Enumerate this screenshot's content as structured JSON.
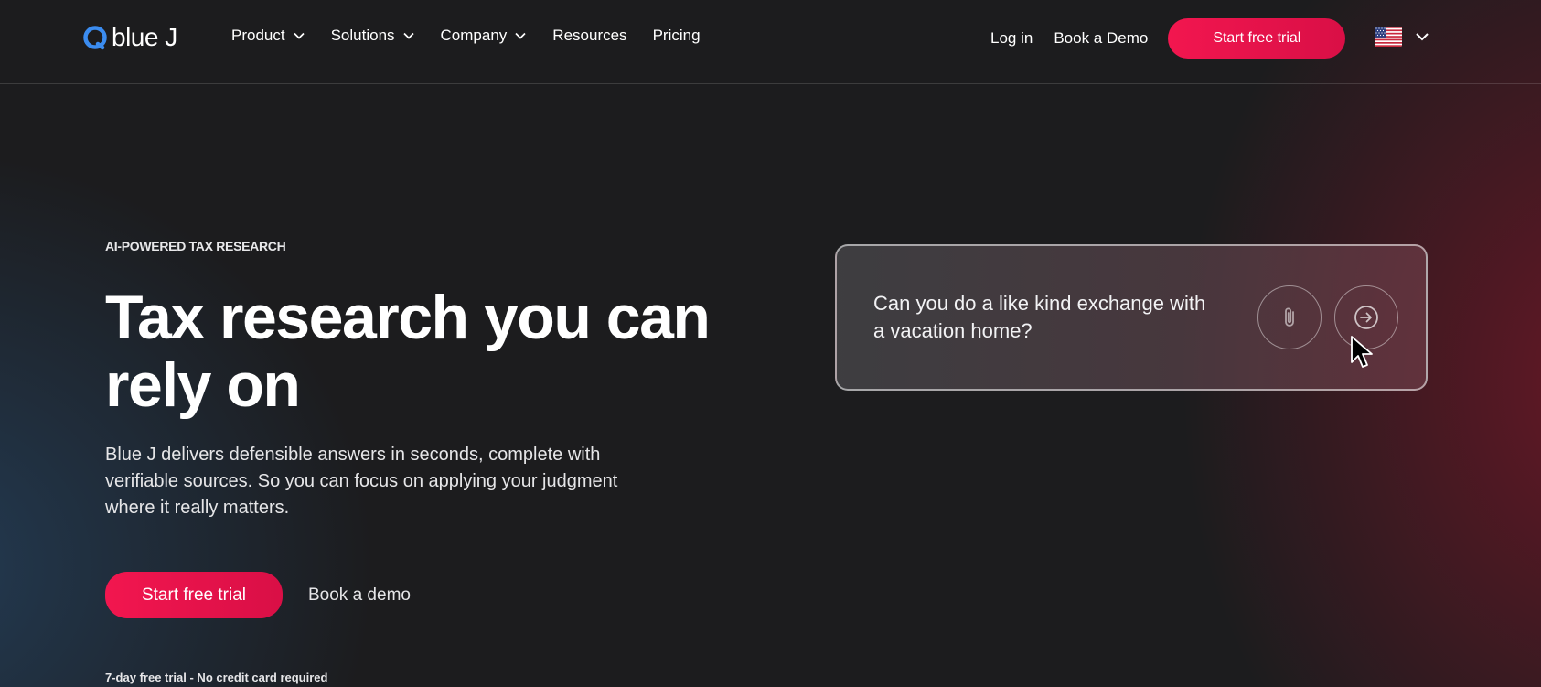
{
  "header": {
    "logo_text": "blue J",
    "nav": [
      {
        "label": "Product",
        "has_menu": true
      },
      {
        "label": "Solutions",
        "has_menu": true
      },
      {
        "label": "Company",
        "has_menu": true
      },
      {
        "label": "Resources",
        "has_menu": false
      },
      {
        "label": "Pricing",
        "has_menu": false
      }
    ],
    "login_label": "Log in",
    "book_demo_label": "Book a Demo",
    "trial_label": "Start free trial"
  },
  "hero": {
    "eyebrow": "AI-POWERED TAX RESEARCH",
    "headline": "Tax research you can rely on",
    "subcopy": "Blue J delivers defensible answers in seconds, complete with verifiable sources. So you can focus on applying your judgment where it really matters.",
    "cta_label": "Start free trial",
    "demo_label": "Book a demo",
    "fineprint": "7-day free trial - No credit card required"
  },
  "demo_card": {
    "query": "Can you do a like kind exchange with a vacation home?"
  },
  "icons": [
    "logo-mark-icon",
    "chevron-down-icon",
    "us-flag-icon",
    "paperclip-icon",
    "arrow-right-circle-icon",
    "cursor-icon"
  ],
  "colors": {
    "accent": "#f2164f",
    "logo_blue": "#3b8cf0",
    "background": "#1c1c1e"
  }
}
